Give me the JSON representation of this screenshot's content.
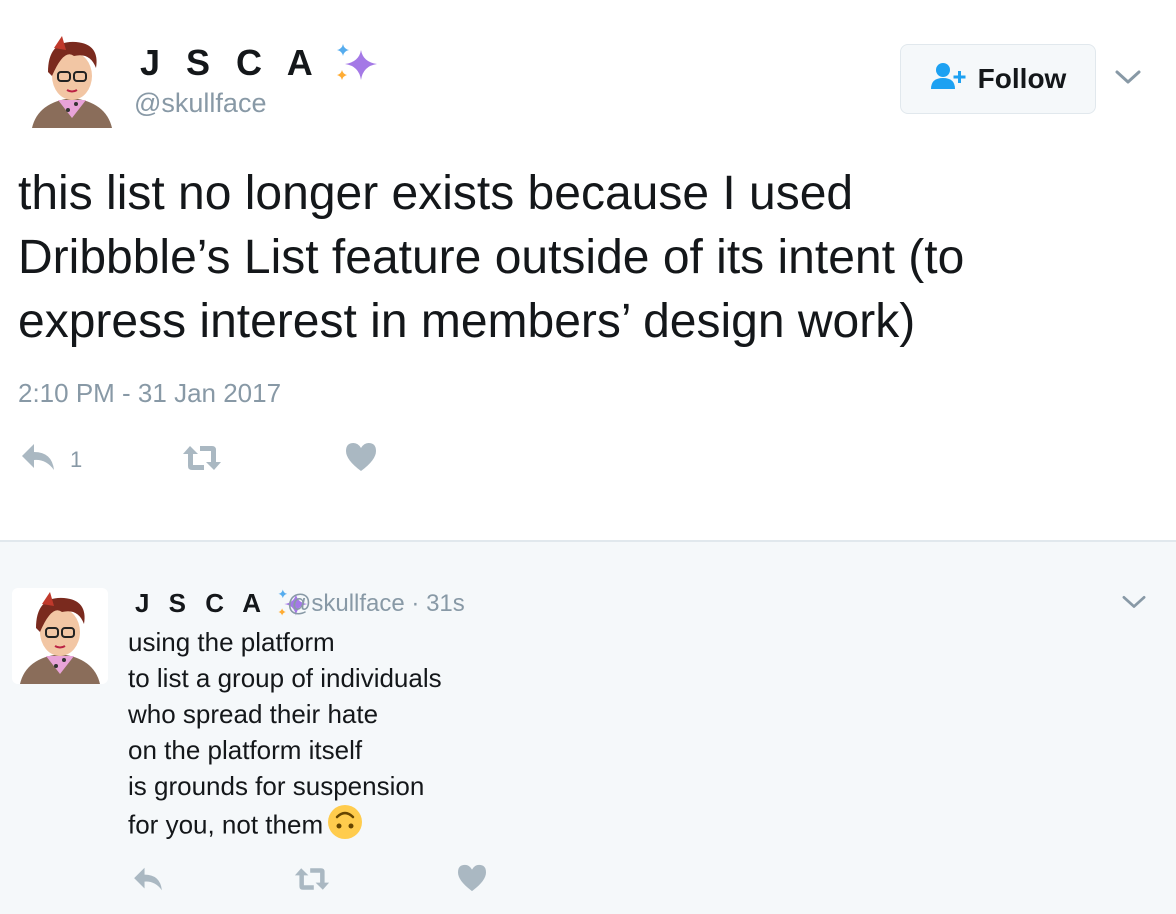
{
  "tweet": {
    "display_name": "J S C A",
    "handle": "@skullface",
    "text": "this list no longer exists because I used\nDribbble’s List feature outside of its intent (to\nexpress interest in members’ design work)",
    "timestamp": "2:10 PM - 31 Jan 2017",
    "reply_count": "1",
    "follow_label": "Follow"
  },
  "reply": {
    "display_name": "J S C A",
    "handle_time": "@skullface · 31s",
    "text": "using the platform\nto list a group of individuals\nwho spread their hate\non the platform itself\nis grounds for suspension\nfor you, not them"
  },
  "colors": {
    "text": "#14171a",
    "muted": "#8899a6",
    "follow_icon": "#1da1f2",
    "border": "#e1e8ed",
    "reply_background": "#f5f8fa",
    "sparkle": "#a479e6"
  },
  "icons": [
    "sparkles-icon",
    "follow-user-icon",
    "chevron-down-icon",
    "reply-icon",
    "retweet-icon",
    "heart-icon",
    "upside-down-face-emoji"
  ]
}
